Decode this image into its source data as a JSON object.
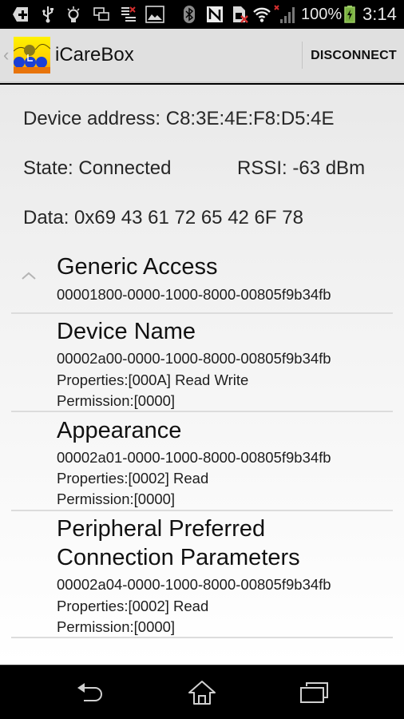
{
  "status_bar": {
    "icons_left": [
      "add-notification-icon",
      "usb-icon",
      "lightbulb-icon",
      "screen-mirror-icon",
      "sync-error-icon",
      "image-icon",
      "bluetooth-icon"
    ],
    "icons_right": [
      "nfc-icon",
      "no-sim-icon",
      "wifi-icon",
      "signal-no-service-icon",
      "battery-charging-icon"
    ],
    "battery": "100%",
    "time": "3:14"
  },
  "action_bar": {
    "title": "iCareBox",
    "disconnect_label": "DISCONNECT"
  },
  "device": {
    "address": "Device address: C8:3E:4E:F8:D5:4E",
    "state": "State: Connected",
    "rssi": "RSSI: -63 dBm",
    "data": "Data: 0x69 43 61 72 65 42 6F 78"
  },
  "service": {
    "name": "Generic Access",
    "uuid": "00001800-0000-1000-8000-00805f9b34fb",
    "expanded": true
  },
  "characteristics": [
    {
      "name": "Device Name",
      "uuid": "00002a00-0000-1000-8000-00805f9b34fb",
      "properties": "Properties:[000A] Read Write",
      "permission": "Permission:[0000]"
    },
    {
      "name": "Appearance",
      "uuid": "00002a01-0000-1000-8000-00805f9b34fb",
      "properties": "Properties:[0002] Read",
      "permission": "Permission:[0000]"
    },
    {
      "name_line1": "Peripheral Preferred",
      "name_line2": "Connection Parameters",
      "uuid": "00002a04-0000-1000-8000-00805f9b34fb",
      "properties": "Properties:[0002] Read",
      "permission": "Permission:[0000]"
    }
  ],
  "nav_bar": {
    "buttons": [
      "back",
      "home",
      "recent-apps"
    ]
  }
}
